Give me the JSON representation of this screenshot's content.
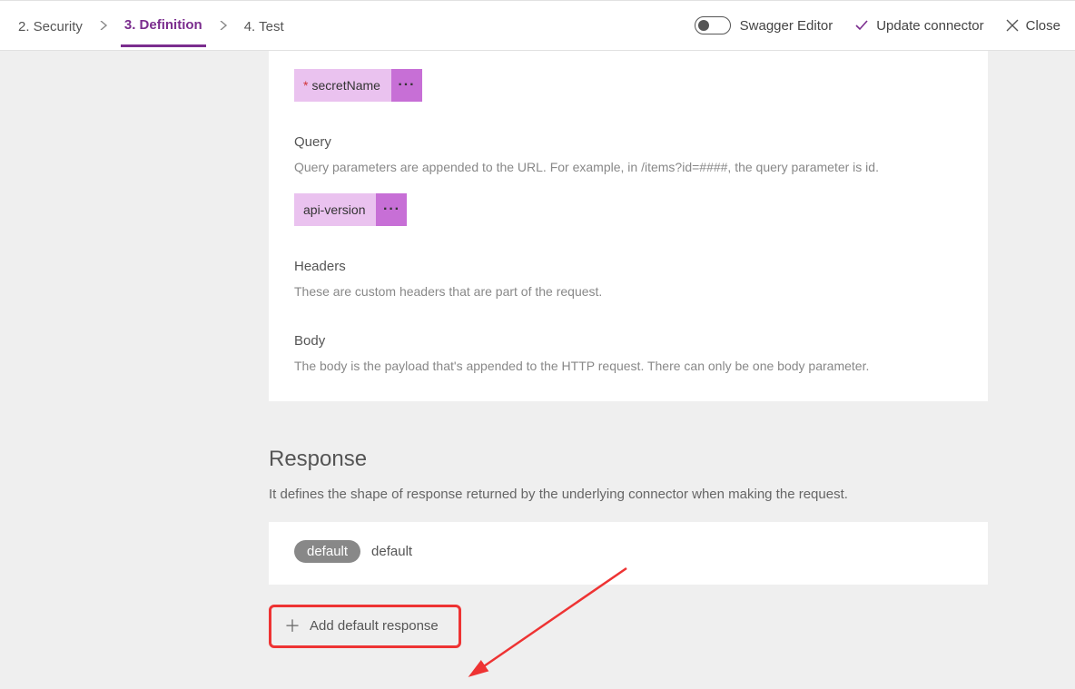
{
  "steps": {
    "security": "2. Security",
    "definition": "3. Definition",
    "test": "4. Test"
  },
  "topbar": {
    "swagger": "Swagger Editor",
    "update": "Update connector",
    "close": "Close"
  },
  "params": {
    "secretName": "secretName",
    "apiVersion": "api-version"
  },
  "query": {
    "title": "Query",
    "desc": "Query parameters are appended to the URL. For example, in /items?id=####, the query parameter is id."
  },
  "headers": {
    "title": "Headers",
    "desc": "These are custom headers that are part of the request."
  },
  "body": {
    "title": "Body",
    "desc": "The body is the payload that's appended to the HTTP request. There can only be one body parameter."
  },
  "response": {
    "title": "Response",
    "desc": "It defines the shape of response returned by the underlying connector when making the request.",
    "pill": "default",
    "label": "default"
  },
  "add": {
    "label": "Add default response"
  }
}
